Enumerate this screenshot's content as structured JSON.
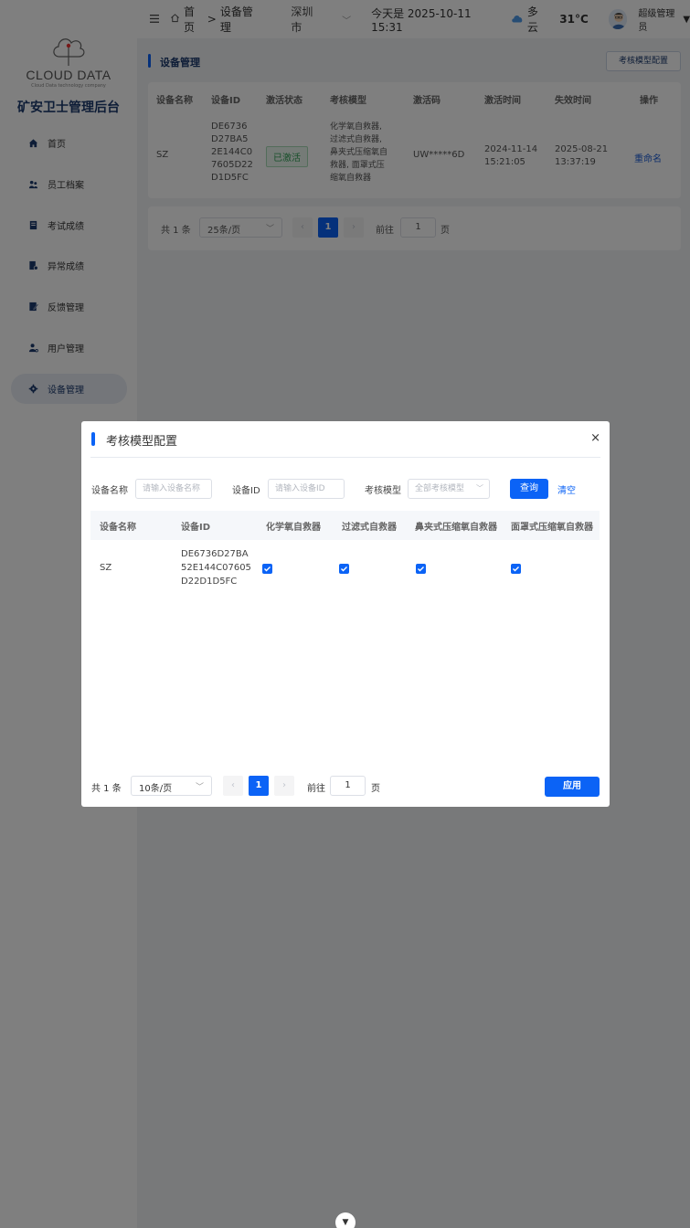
{
  "sidebar": {
    "logo_text": "CLOUD  DATA",
    "logo_sub": "Cloud Data technology company",
    "app_title": "矿安卫士管理后台",
    "items": [
      {
        "label": "首页",
        "icon": "home-icon"
      },
      {
        "label": "员工档案",
        "icon": "staff-icon"
      },
      {
        "label": "考试成绩",
        "icon": "exam-icon"
      },
      {
        "label": "异常成绩",
        "icon": "abnormal-icon"
      },
      {
        "label": "反馈管理",
        "icon": "feedback-icon"
      },
      {
        "label": "用户管理",
        "icon": "user-icon"
      },
      {
        "label": "设备管理",
        "icon": "gear-icon"
      }
    ]
  },
  "header": {
    "breadcrumb_home": "首页",
    "breadcrumb_sep": ">",
    "breadcrumb_current": "设备管理",
    "city": "深圳市",
    "today": "今天是 2025-10-11 15:31",
    "weather": "多云",
    "temperature": "31°C",
    "user": "超级管理员"
  },
  "main": {
    "title": "设备管理",
    "config_button": "考核模型配置",
    "columns": [
      "设备名称",
      "设备ID",
      "激活状态",
      "考核模型",
      "激活码",
      "激活时间",
      "失效时间",
      "操作"
    ],
    "row": {
      "name": "SZ",
      "id_lines": [
        "DE6736",
        "D27BA5",
        "2E144C0",
        "7605D22",
        "D1D5FC"
      ],
      "status": "已激活",
      "model_lines": [
        "化学氧自救器,",
        "过滤式自救器,",
        "鼻夹式压缩氧自",
        "救器, 面罩式压",
        "缩氧自救器"
      ],
      "code": "UW*****6D",
      "activate_date": "2024-11-14",
      "activate_time": "15:21:05",
      "expire_date": "2025-08-21",
      "expire_time": "13:37:19",
      "action": "重命名"
    },
    "pager": {
      "total": "共 1 条",
      "page_size": "25条/页",
      "page": "1",
      "goto": "前往",
      "goto_value": "1",
      "page_unit": "页"
    }
  },
  "modal": {
    "title": "考核模型配置",
    "close": "×",
    "filter": {
      "name_label": "设备名称",
      "name_placeholder": "请输入设备名称",
      "id_label": "设备ID",
      "id_placeholder": "请输入设备ID",
      "model_label": "考核模型",
      "model_placeholder": "全部考核模型",
      "query": "查询",
      "clear": "清空"
    },
    "columns": [
      "设备名称",
      "设备ID",
      "化学氧自救器",
      "过滤式自救器",
      "鼻夹式压缩氧自救器",
      "面罩式压缩氧自救器"
    ],
    "row": {
      "name": "SZ",
      "id_lines": [
        "DE6736D27BA",
        "52E144C07605",
        "D22D1D5FC"
      ],
      "checked": [
        true,
        true,
        true,
        true
      ]
    },
    "pager": {
      "total": "共 1 条",
      "page_size": "10条/页",
      "page": "1",
      "goto": "前往",
      "goto_value": "1",
      "page_unit": "页"
    },
    "apply": "应用"
  },
  "colors": {
    "primary": "#0b63f6",
    "navy": "#1d3b6e",
    "success": "#2e9e55"
  }
}
